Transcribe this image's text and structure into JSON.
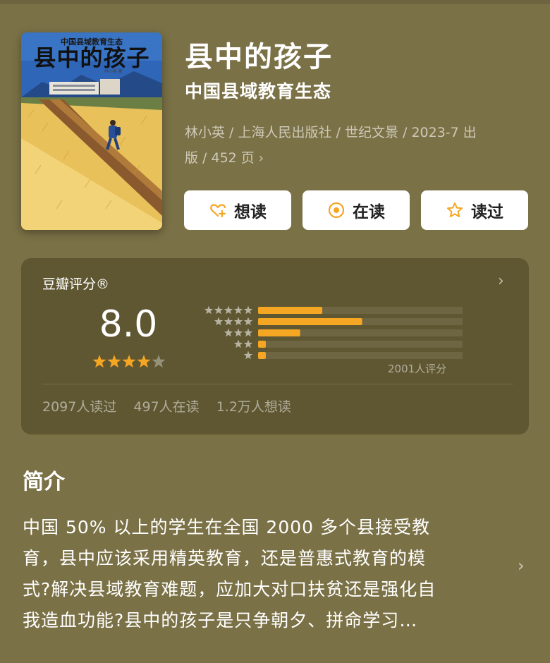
{
  "book": {
    "cover_title": "县中的孩子",
    "cover_subtitle": "中国县域教育生态",
    "cover_author": "林小英 著",
    "title": "县中的孩子",
    "subtitle": "中国县域教育生态",
    "meta_line1": "林小英 / 上海人民出版社 / 世纪文景 / 2023-7 出",
    "meta_line2": "版 / 452 页"
  },
  "actions": {
    "want_label": "想读",
    "reading_label": "在读",
    "read_label": "读过"
  },
  "rating": {
    "label": "豆瓣评分®",
    "score": "8.0",
    "stars_filled": 4,
    "stars_total": 5,
    "count_text": "2001人评分",
    "distribution": [
      {
        "stars": 5,
        "fraction": 0.29
      },
      {
        "stars": 4,
        "fraction": 0.47
      },
      {
        "stars": 3,
        "fraction": 0.19
      },
      {
        "stars": 2,
        "fraction": 0.035
      },
      {
        "stars": 1,
        "fraction": 0.035
      }
    ],
    "stats": {
      "read": "2097人读过",
      "reading": "497人在读",
      "want": "1.2万人想读"
    }
  },
  "intro": {
    "heading": "简介",
    "lines": [
      "中国 50% 以上的学生在全国 2000 多个县接受教",
      "育，县中应该采用精英教育，还是普惠式教育的模",
      "式?解决县域教育难题，应加大对口扶贫还是强化自",
      "我造血功能?县中的孩子是只争朝夕、拼命学习…"
    ]
  },
  "colors": {
    "background": "#7b7146",
    "card": "#5f5732",
    "accent": "#f5a623",
    "bar_track": "#6e6643"
  },
  "icons": {
    "want": "heart-plus-icon",
    "reading": "target-icon",
    "read": "star-outline-icon",
    "more": "chevron-right-icon"
  }
}
